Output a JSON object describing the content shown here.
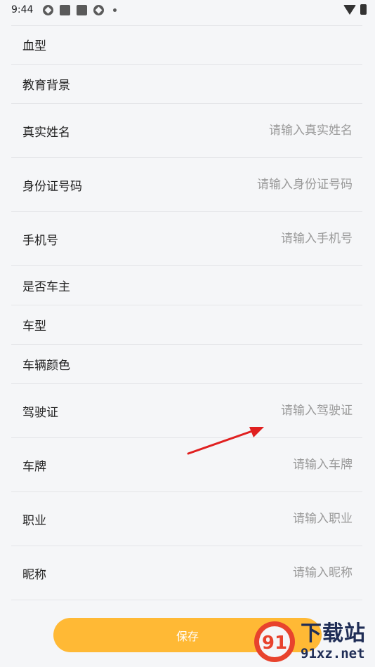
{
  "status_bar": {
    "time": "9:44",
    "icons": [
      "app-circle-icon",
      "app-square-icon",
      "app-square-icon",
      "app-circle-icon",
      "dot-icon"
    ],
    "right_icons": [
      "wifi-icon",
      "battery-icon"
    ]
  },
  "form": {
    "rows": [
      {
        "label": "血型",
        "placeholder": ""
      },
      {
        "label": "教育背景",
        "placeholder": ""
      },
      {
        "label": "真实姓名",
        "placeholder": "请输入真实姓名"
      },
      {
        "label": "身份证号码",
        "placeholder": "请输入身份证号码"
      },
      {
        "label": "手机号",
        "placeholder": "请输入手机号"
      },
      {
        "label": "是否车主",
        "placeholder": ""
      },
      {
        "label": "车型",
        "placeholder": ""
      },
      {
        "label": "车辆颜色",
        "placeholder": ""
      },
      {
        "label": "驾驶证",
        "placeholder": "请输入驾驶证"
      },
      {
        "label": "车牌",
        "placeholder": "请输入车牌"
      },
      {
        "label": "职业",
        "placeholder": "请输入职业"
      },
      {
        "label": "昵称",
        "placeholder": "请输入昵称"
      }
    ]
  },
  "save_button": {
    "label": "保存",
    "color": "#ffb935"
  },
  "annotation": {
    "arrow_color": "#e02020"
  },
  "watermark": {
    "cn": "下载站",
    "en": "91xz.net",
    "logo_text": "91"
  }
}
